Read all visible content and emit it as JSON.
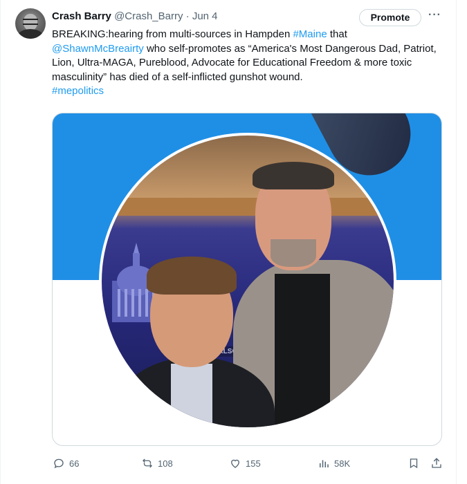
{
  "tweet": {
    "author_name": "Crash Barry",
    "handle": "@Crash_Barry",
    "separator": "·",
    "date": "Jun 4",
    "promote_label": "Promote",
    "more_label": "···",
    "text": {
      "p1": "BREAKING:hearing from multi-sources in Hampden ",
      "hashtag_maine": "#Maine",
      "p2": " that ",
      "mention": "@ShawnMcBreairty",
      "p3": " who self-promotes as “America's Most Dangerous Dad, Patriot, Lion, Ultra-MAGA, Pureblood, Advocate for Educational Freedom & more toxic masculinity” has died of a self-inflicted gunshot wound.",
      "hashtag_mepolitics": "#mepolitics"
    },
    "media_caption_text": "CARLSO"
  },
  "actions": {
    "replies": "66",
    "reposts": "108",
    "likes": "155",
    "views": "58K"
  },
  "colors": {
    "link": "#1d9bf0",
    "secondary_text": "#536471",
    "banner_blue": "#1f8fe6"
  },
  "icons": [
    "reply-icon",
    "repost-icon",
    "like-icon",
    "views-icon",
    "bookmark-icon",
    "share-icon"
  ]
}
